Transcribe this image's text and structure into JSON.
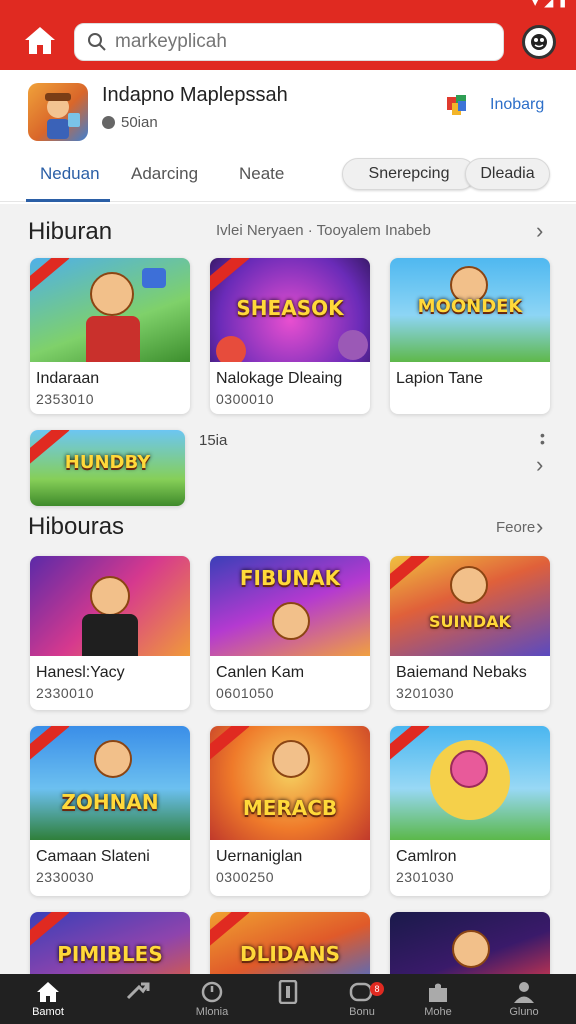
{
  "search": {
    "placeholder": "markeyplicah"
  },
  "app": {
    "title": "Indapno Maplepssah",
    "meta": "50ian",
    "install_label": "Inobarg"
  },
  "tabs": [
    {
      "label": "Neduan"
    },
    {
      "label": "Adarcing"
    },
    {
      "label": "Neate"
    }
  ],
  "chips": [
    {
      "label": "Snerepcing"
    },
    {
      "label": "Dleadia"
    }
  ],
  "section1": {
    "title": "Hiburan",
    "subtitle": "Ivlei Neryaen · Tooyalem Inabeb",
    "cards": [
      {
        "name": "Indaraan",
        "num": "2353010",
        "banner": ""
      },
      {
        "name": "Nalokage Dleaing",
        "num": "0300010",
        "banner": "SHEASOK"
      },
      {
        "name": "Lapion Tane",
        "num": "",
        "banner": "MOONDEK"
      }
    ],
    "extra_card": {
      "banner": "HUNDBY",
      "side_label": "15ia"
    }
  },
  "section2": {
    "title": "Hibouras",
    "more_label": "Feore",
    "cards": [
      {
        "name": "Hanesl:Yacy",
        "num": "2330010",
        "banner": ""
      },
      {
        "name": "Canlen Kam",
        "num": "0601050",
        "banner": "FIBUNAK"
      },
      {
        "name": "Baiemand Nebaks",
        "num": "3201030",
        "banner": "SUINDAK"
      },
      {
        "name": "Camaan Slateni",
        "num": "2330030",
        "banner": "ZOHNAN"
      },
      {
        "name": "Uernaniglan",
        "num": "0300250",
        "banner": "MERACB"
      },
      {
        "name": "Camlron",
        "num": "2301030",
        "banner": ""
      },
      {
        "name": "",
        "num": "",
        "banner": "PIMIBLES"
      },
      {
        "name": "",
        "num": "",
        "banner": "DLIDANS"
      },
      {
        "name": "",
        "num": "",
        "banner": ""
      }
    ]
  },
  "nav": [
    {
      "label": "Bamot"
    },
    {
      "label": ""
    },
    {
      "label": "Mlonia"
    },
    {
      "label": ""
    },
    {
      "label": "Bonu",
      "badge": "8"
    },
    {
      "label": "Mohe"
    },
    {
      "label": "Gluno"
    }
  ],
  "colors": {
    "accent": "#e02a21",
    "tab_active": "#2b5fa6",
    "nav_bg": "#212121"
  }
}
